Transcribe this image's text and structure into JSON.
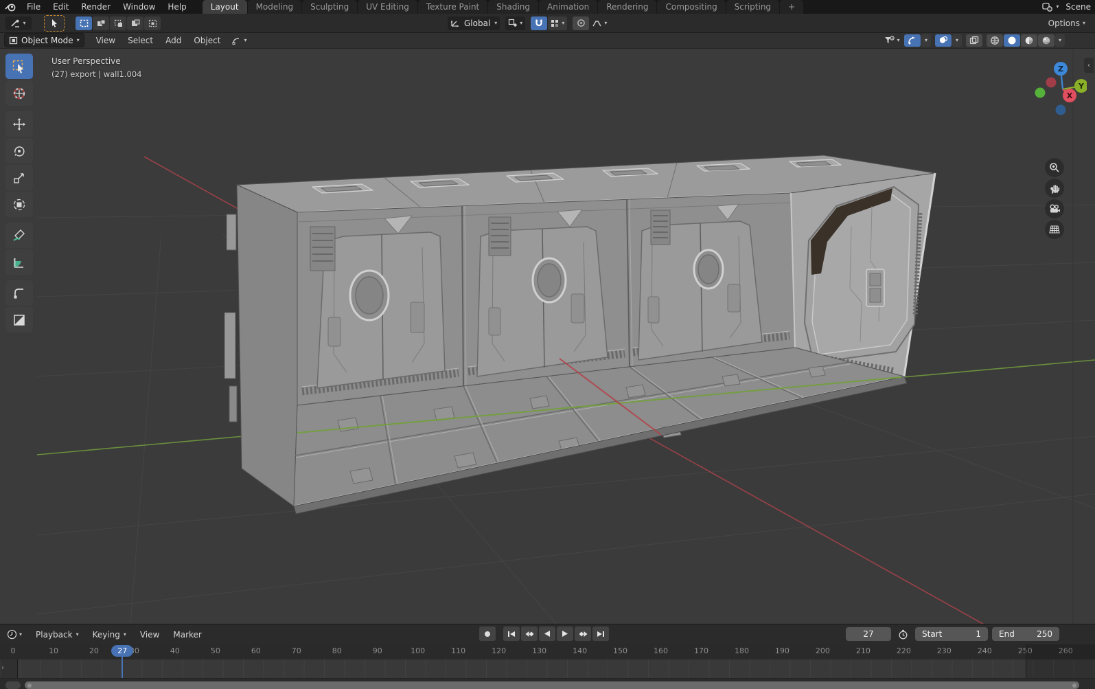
{
  "topbar": {
    "menus": [
      "File",
      "Edit",
      "Render",
      "Window",
      "Help"
    ],
    "tabs": [
      {
        "label": "Layout",
        "active": true
      },
      {
        "label": "Modeling"
      },
      {
        "label": "Sculpting"
      },
      {
        "label": "UV Editing"
      },
      {
        "label": "Texture Paint"
      },
      {
        "label": "Shading"
      },
      {
        "label": "Animation"
      },
      {
        "label": "Rendering"
      },
      {
        "label": "Compositing"
      },
      {
        "label": "Scripting"
      },
      {
        "label": "+"
      }
    ],
    "scene_label": "Scene"
  },
  "tool_settings": {
    "orientation": "Global",
    "options_label": "Options"
  },
  "viewport_header": {
    "mode": "Object Mode",
    "menus": [
      "View",
      "Select",
      "Add",
      "Object"
    ]
  },
  "viewport": {
    "view_label": "User Perspective",
    "object_label": "(27) export | wall1.004",
    "axis_labels": {
      "x": "X",
      "y": "Y",
      "z": "Z"
    },
    "tools": [
      "select-box",
      "cursor",
      "move",
      "rotate",
      "scale",
      "transform",
      "annotate",
      "measure",
      "corner-pin",
      "add-cube"
    ]
  },
  "timeline": {
    "menus": [
      {
        "label": "Playback",
        "chevron": true
      },
      {
        "label": "Keying",
        "chevron": true
      },
      {
        "label": "View",
        "chevron": false
      },
      {
        "label": "Marker",
        "chevron": false
      }
    ],
    "frame_current": 27,
    "start_label": "Start",
    "start": "1",
    "end_label": "End",
    "end": "250",
    "ruler": [
      0,
      10,
      20,
      30,
      40,
      50,
      60,
      70,
      80,
      90,
      100,
      110,
      120,
      130,
      140,
      150,
      160,
      170,
      180,
      190,
      200,
      210,
      220,
      230,
      240,
      250,
      260
    ]
  },
  "colors": {
    "accent": "#4772b3",
    "topbar_bg": "#181818",
    "viewport_bg": "#3b3b3b",
    "grid_line": "#464646",
    "axis_green": "#739f3d",
    "axis_red": "#b2434b",
    "gizmo_x": "#e04f5f",
    "gizmo_y": "#8bb029",
    "gizmo_z": "#3d88d8",
    "text": "#d9d9d9"
  }
}
